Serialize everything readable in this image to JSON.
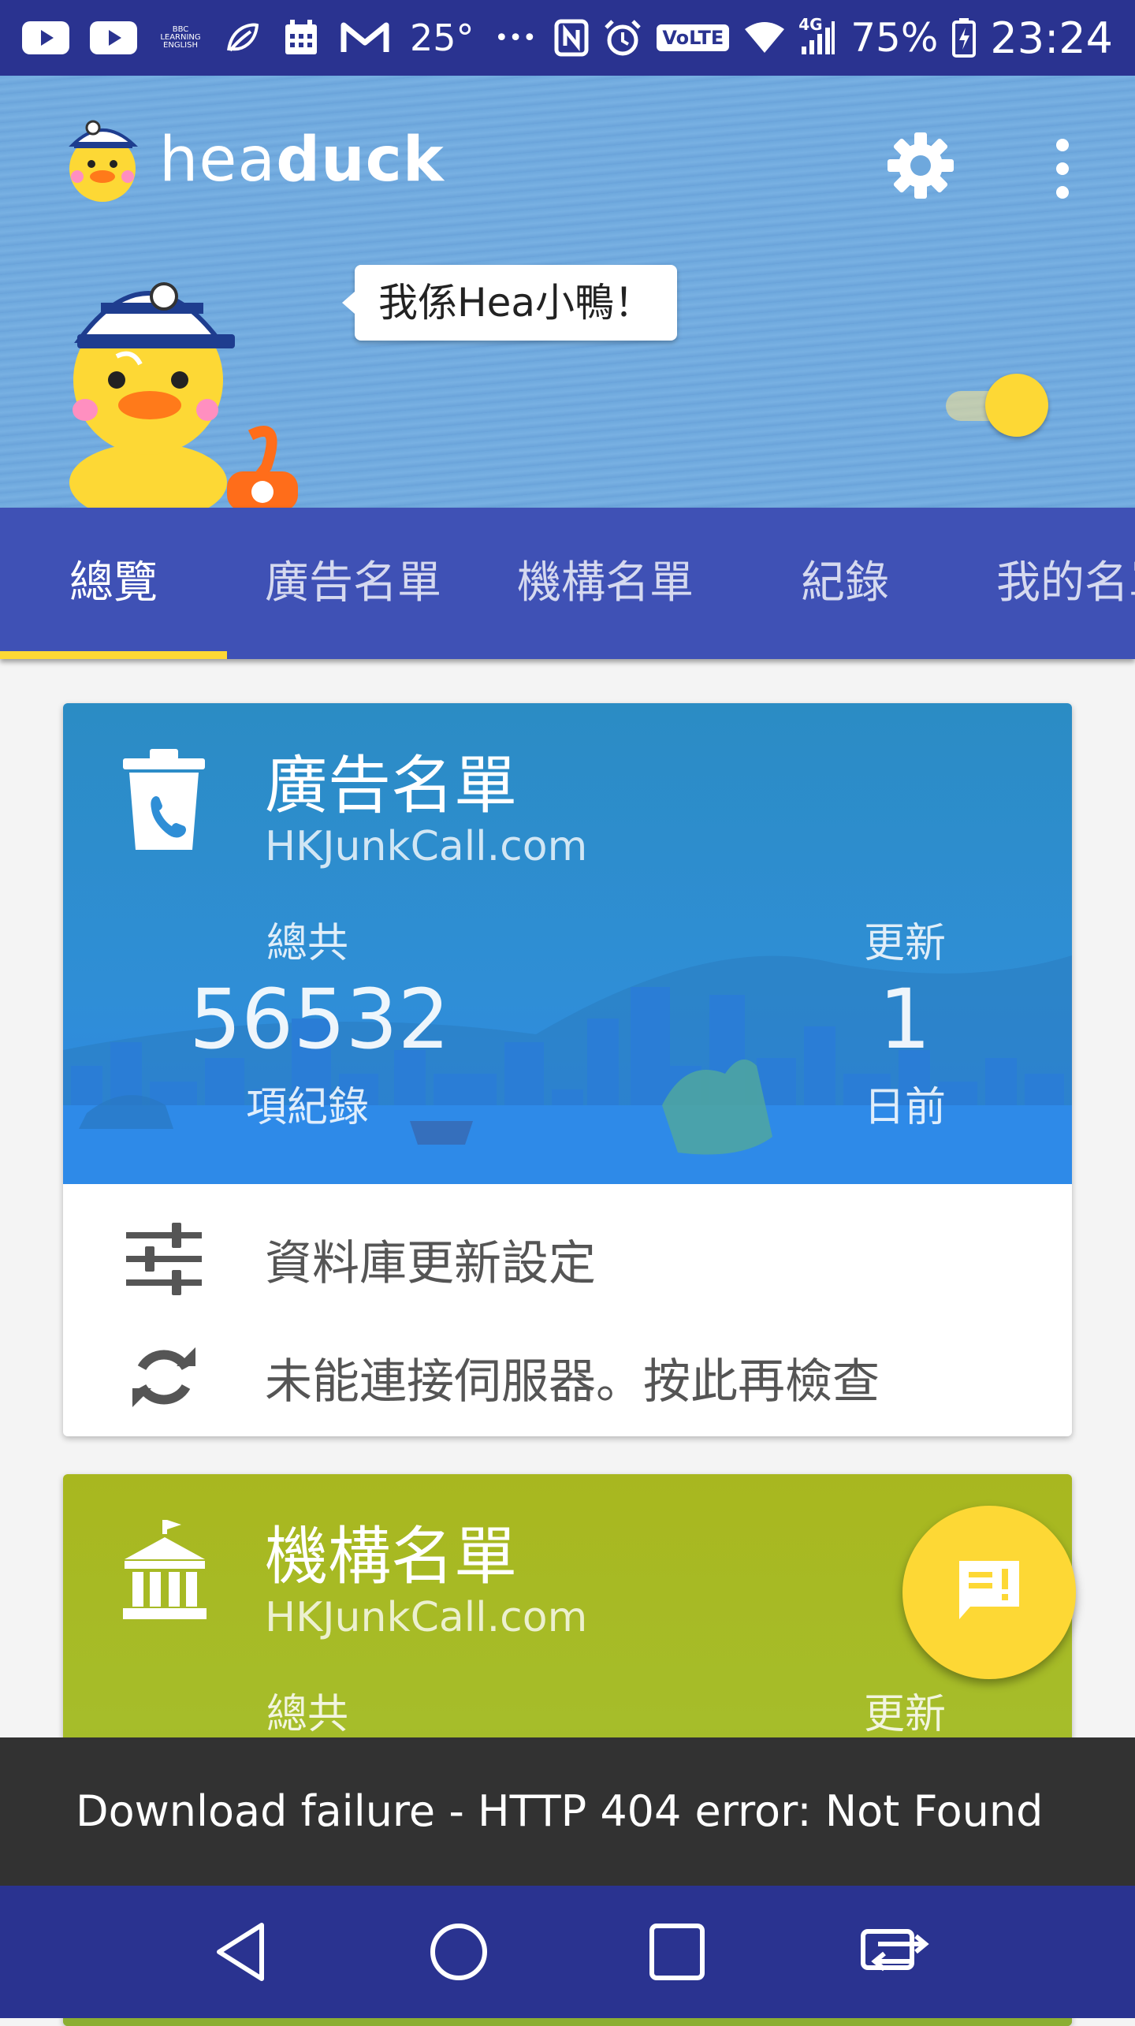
{
  "status_bar": {
    "bbc_label": "BBC LEARNING ENGLISH",
    "temperature": "25°",
    "more": "•••",
    "volte": "VoLTE",
    "network": "4G",
    "battery": "75%",
    "time": "23:24"
  },
  "app": {
    "brand_light": "hea",
    "brand_bold": "duck",
    "greeting": "我係Hea小鴨！"
  },
  "tabs": [
    {
      "label": "總覽",
      "active": true
    },
    {
      "label": "廣告名單",
      "active": false
    },
    {
      "label": "機構名單",
      "active": false
    },
    {
      "label": "紀錄",
      "active": false
    },
    {
      "label": "我的名單",
      "active": false
    }
  ],
  "ad_card": {
    "title": "廣告名單",
    "source": "HKJunkCall.com",
    "total_label": "總共",
    "total_value": "56532",
    "total_unit": "項紀錄",
    "update_label": "更新",
    "update_value": "1",
    "update_unit": "日前",
    "rows": [
      {
        "label": "資料庫更新設定",
        "icon": "tune-icon"
      },
      {
        "label": "未能連接伺服器。按此再檢查",
        "icon": "refresh-icon"
      }
    ]
  },
  "org_card": {
    "title": "機構名單",
    "source": "HKJunkCall.com",
    "total_label": "總共",
    "update_label": "更新"
  },
  "snackbar": {
    "message": "Download failure - HTTP 404 error: Not Found"
  },
  "colors": {
    "status_bar": "#2a3390",
    "tab_bar": "#3f51b5",
    "tab_indicator": "#fdd835",
    "ad_card": "#2f8ed6",
    "org_card": "#a6bd2a",
    "fab": "#fdd835",
    "snackbar": "#323232"
  }
}
